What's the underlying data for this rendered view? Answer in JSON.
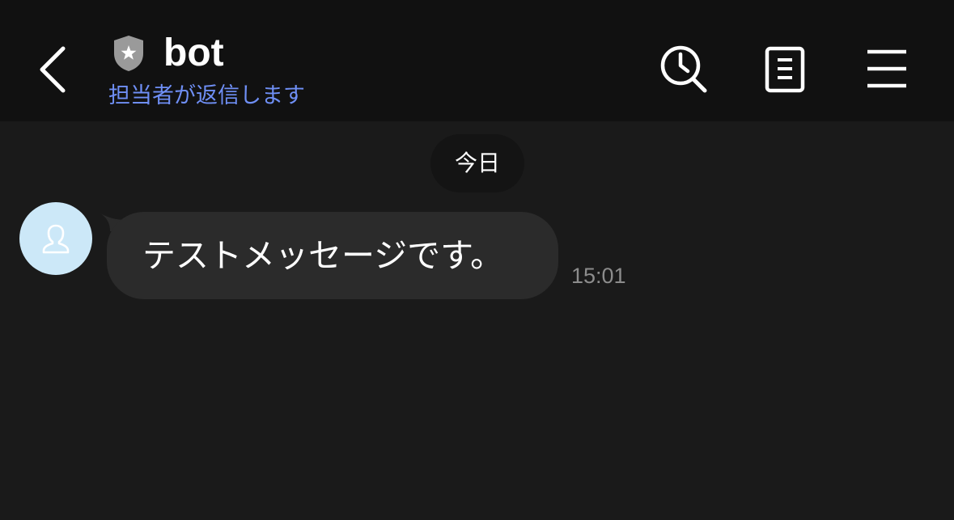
{
  "header": {
    "back_icon": "chevron-left-icon",
    "badge_icon": "shield-star-icon",
    "title": "bot",
    "status": "担当者が返信します",
    "actions": [
      {
        "name": "history-search",
        "icon": "clock-search-icon"
      },
      {
        "name": "notes",
        "icon": "document-icon"
      },
      {
        "name": "menu",
        "icon": "hamburger-menu-icon"
      }
    ]
  },
  "chat": {
    "date_separator": "今日",
    "messages": [
      {
        "avatar_icon": "user-silhouette-icon",
        "text": "テストメッセージです。",
        "time": "15:01"
      }
    ]
  },
  "colors": {
    "background": "#1a1a1a",
    "header_background": "#111111",
    "status_text": "#6f8ff5",
    "bubble": "#2b2b2b",
    "avatar_background": "#cce8f8",
    "timestamp": "#8c8c8c"
  }
}
